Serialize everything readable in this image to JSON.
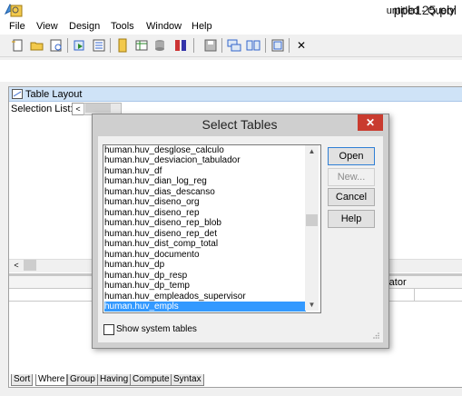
{
  "app": {
    "title": "ppb125.pbl"
  },
  "menu": [
    "File",
    "View",
    "Design",
    "Tools",
    "Window",
    "Help"
  ],
  "toolbar": {
    "icons": [
      "new-icon",
      "open-icon",
      "preview-icon",
      "run-icon",
      "data-icon",
      "arrange-icon",
      "database-icon",
      "sql-icon",
      "save-icon",
      "cascade-icon",
      "tile-icon",
      "window-icon",
      "close-icon"
    ],
    "close_glyph": "✕"
  },
  "query": {
    "window_title": "untitled - Query"
  },
  "layout": {
    "pane_title": "Table Layout",
    "selection_label": "Selection List:",
    "scroll_left": "<",
    "grid_header_fragment": "rator"
  },
  "tabs": [
    "Sort",
    "Where",
    "Group",
    "Having",
    "Compute",
    "Syntax"
  ],
  "dialog": {
    "title": "Select Tables",
    "close_glyph": "✕",
    "tables": [
      "human.huv_desglose_calculo",
      "human.huv_desviacion_tabulador",
      "human.huv_df",
      "human.huv_dian_log_reg",
      "human.huv_dias_descanso",
      "human.huv_diseno_org",
      "human.huv_diseno_rep",
      "human.huv_diseno_rep_blob",
      "human.huv_diseno_rep_det",
      "human.huv_dist_comp_total",
      "human.huv_documento",
      "human.huv_dp",
      "human.huv_dp_resp",
      "human.huv_dp_temp",
      "human.huv_empleados_supervisor",
      "human.huv_empls"
    ],
    "selected_table": "human.huv_empls",
    "buttons": {
      "open": "Open",
      "new": "New...",
      "cancel": "Cancel",
      "help": "Help"
    },
    "show_system_tables_label": "Show system tables",
    "show_system_tables_checked": false,
    "scroll_up": "▲",
    "scroll_down": "▼"
  }
}
